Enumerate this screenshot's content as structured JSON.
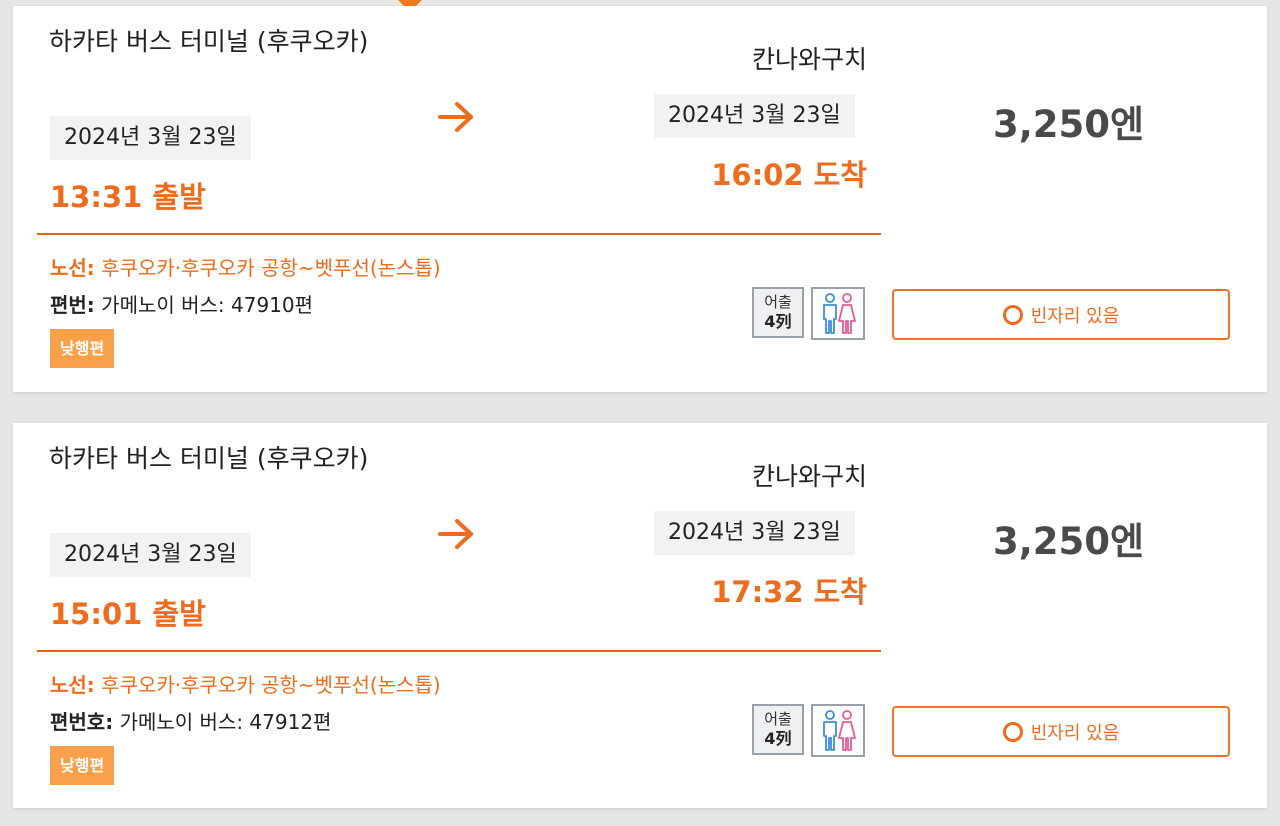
{
  "colors": {
    "accent": "#ef6c1c",
    "day_tag": "#f9a04a",
    "divider": "#e3651a",
    "price": "#4a4a4a",
    "background": "#e6e6e6",
    "card": "#ffffff",
    "date_chip": "#f2f2f2"
  },
  "icons": {
    "pointer": "caret-down-icon",
    "arrow": "arrow-right-icon",
    "toilet": "restroom-icon",
    "availability": "circle-icon"
  },
  "results": [
    {
      "origin": "하카타 버스 터미널 (후쿠오카)",
      "departure_date": "2024년 3월 23일",
      "departure_time": "13:31 출발",
      "destination": "칸나와구치",
      "arrival_date": "2024년 3월 23일",
      "arrival_time": "16:02 도착",
      "price": "3,250엔",
      "route_label": "노선:",
      "route": "후쿠오카·후쿠오카 공항~벳푸선(논스톱)",
      "flight_label": "편번:",
      "flight": "가메노이 버스: 47910편",
      "day_tag": "낮행편",
      "seat_type_line1": "어출",
      "seat_type_line2": "4列",
      "availability": "빈자리 있음"
    },
    {
      "origin": "하카타 버스 터미널 (후쿠오카)",
      "departure_date": "2024년 3월 23일",
      "departure_time": "15:01 출발",
      "destination": "칸나와구치",
      "arrival_date": "2024년 3월 23일",
      "arrival_time": "17:32 도착",
      "price": "3,250엔",
      "route_label": "노선:",
      "route": "후쿠오카·후쿠오카 공항~벳푸선(논스톱)",
      "flight_label": "편번호:",
      "flight": "가메노이 버스: 47912편",
      "day_tag": "낮행편",
      "seat_type_line1": "어출",
      "seat_type_line2": "4列",
      "availability": "빈자리 있음"
    }
  ]
}
